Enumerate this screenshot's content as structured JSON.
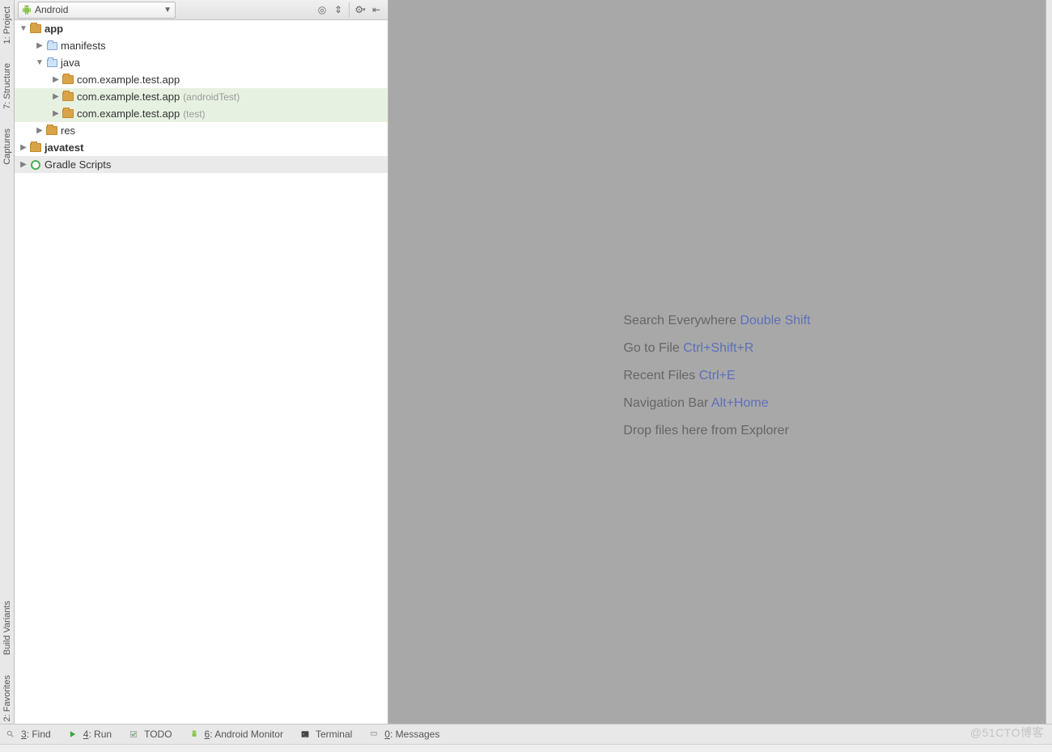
{
  "leftbar": {
    "tabs": [
      {
        "label": "1: Project"
      },
      {
        "label": "7: Structure"
      },
      {
        "label": "Captures"
      },
      {
        "label": "Build Variants"
      },
      {
        "label": "2: Favorites"
      }
    ]
  },
  "panel": {
    "title": "Android"
  },
  "tree": {
    "root": [
      {
        "label": "app",
        "bold": true,
        "expanded": true,
        "icon": "module-folder",
        "level": 0,
        "children": [
          {
            "label": "manifests",
            "icon": "folder-blue",
            "level": 1,
            "expanded": false,
            "hasChildren": true
          },
          {
            "label": "java",
            "icon": "folder-blue",
            "level": 1,
            "expanded": true,
            "hasChildren": true,
            "children": [
              {
                "label": "com.example.test.app",
                "icon": "package-folder",
                "level": 2,
                "expanded": false,
                "hasChildren": true
              },
              {
                "label": "com.example.test.app",
                "note": "(androidTest)",
                "icon": "package-folder",
                "level": 2,
                "highlight": true,
                "expanded": false,
                "hasChildren": true
              },
              {
                "label": "com.example.test.app",
                "note": "(test)",
                "icon": "package-folder",
                "level": 2,
                "highlight": true,
                "expanded": false,
                "hasChildren": true
              }
            ]
          },
          {
            "label": "res",
            "icon": "package-folder",
            "level": 1,
            "expanded": false,
            "hasChildren": true
          }
        ]
      },
      {
        "label": "javatest",
        "bold": true,
        "icon": "module-folder",
        "level": 0,
        "expanded": false,
        "hasChildren": true
      },
      {
        "label": "Gradle Scripts",
        "icon": "gradle",
        "level": 0,
        "expanded": false,
        "hasChildren": true,
        "selected": true
      }
    ]
  },
  "tips": [
    {
      "text": "Search Everywhere",
      "key": "Double Shift"
    },
    {
      "text": "Go to File",
      "key": "Ctrl+Shift+R"
    },
    {
      "text": "Recent Files",
      "key": "Ctrl+E"
    },
    {
      "text": "Navigation Bar",
      "key": "Alt+Home"
    },
    {
      "text": "Drop files here from Explorer",
      "key": ""
    }
  ],
  "bottombar": [
    {
      "label": "3: Find",
      "underline": "3",
      "icon": "search"
    },
    {
      "label": "4: Run",
      "underline": "4",
      "icon": "run"
    },
    {
      "label": "TODO",
      "underline": "",
      "icon": "todo"
    },
    {
      "label": "6: Android Monitor",
      "underline": "6",
      "icon": "android"
    },
    {
      "label": "Terminal",
      "underline": "",
      "icon": "terminal"
    },
    {
      "label": "0: Messages",
      "underline": "0",
      "icon": "messages"
    }
  ],
  "watermark": "@51CTO博客"
}
